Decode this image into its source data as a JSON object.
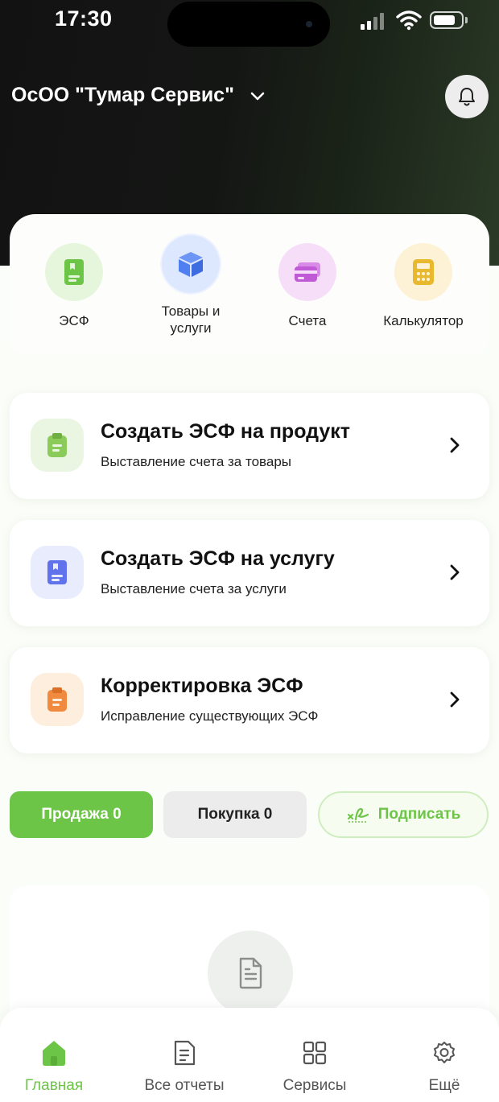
{
  "status_bar": {
    "time": "17:30"
  },
  "header": {
    "company_name": "ОсОО \"Тумар Сервис\""
  },
  "quick_actions": [
    {
      "label": "ЭСФ",
      "icon": "document-icon",
      "color": "#6dc548",
      "bg": "#e6f6dd"
    },
    {
      "label": "Товары и\nуслуги",
      "icon": "cube-icon",
      "color": "#4f7ff0",
      "bg": "#dde8ff"
    },
    {
      "label": "Счета",
      "icon": "card-icon",
      "color": "#c05ad6",
      "bg": "#f6def8"
    },
    {
      "label": "Калькулятор",
      "icon": "calculator-icon",
      "color": "#e8b82e",
      "bg": "#fdf1d6"
    }
  ],
  "cards": [
    {
      "title": "Создать ЭСФ на продукт",
      "subtitle": "Выставление счета за товары",
      "icon_color": "#8bcb5a",
      "icon_bg": "#eaf5e2"
    },
    {
      "title": "Создать ЭСФ на услугу",
      "subtitle": "Выставление счета за услуги",
      "icon_color": "#6173ec",
      "icon_bg": "#e9ecfd"
    },
    {
      "title": "Корректировка ЭСФ",
      "subtitle": "Исправление существующих ЭСФ",
      "icon_color": "#ef8a3e",
      "icon_bg": "#fdeede"
    }
  ],
  "tabs": {
    "sale": "Продажа 0",
    "purchase": "Покупка 0",
    "sign": "Подписать"
  },
  "bottom_nav": [
    {
      "label": "Главная",
      "icon": "home-icon",
      "active": true
    },
    {
      "label": "Все отчеты",
      "icon": "report-icon",
      "active": false
    },
    {
      "label": "Сервисы",
      "icon": "services-grid-icon",
      "active": false
    },
    {
      "label": "Ещё",
      "icon": "settings-icon",
      "active": false
    }
  ],
  "colors": {
    "accent": "#6dc548",
    "header_dark": "#141614"
  }
}
